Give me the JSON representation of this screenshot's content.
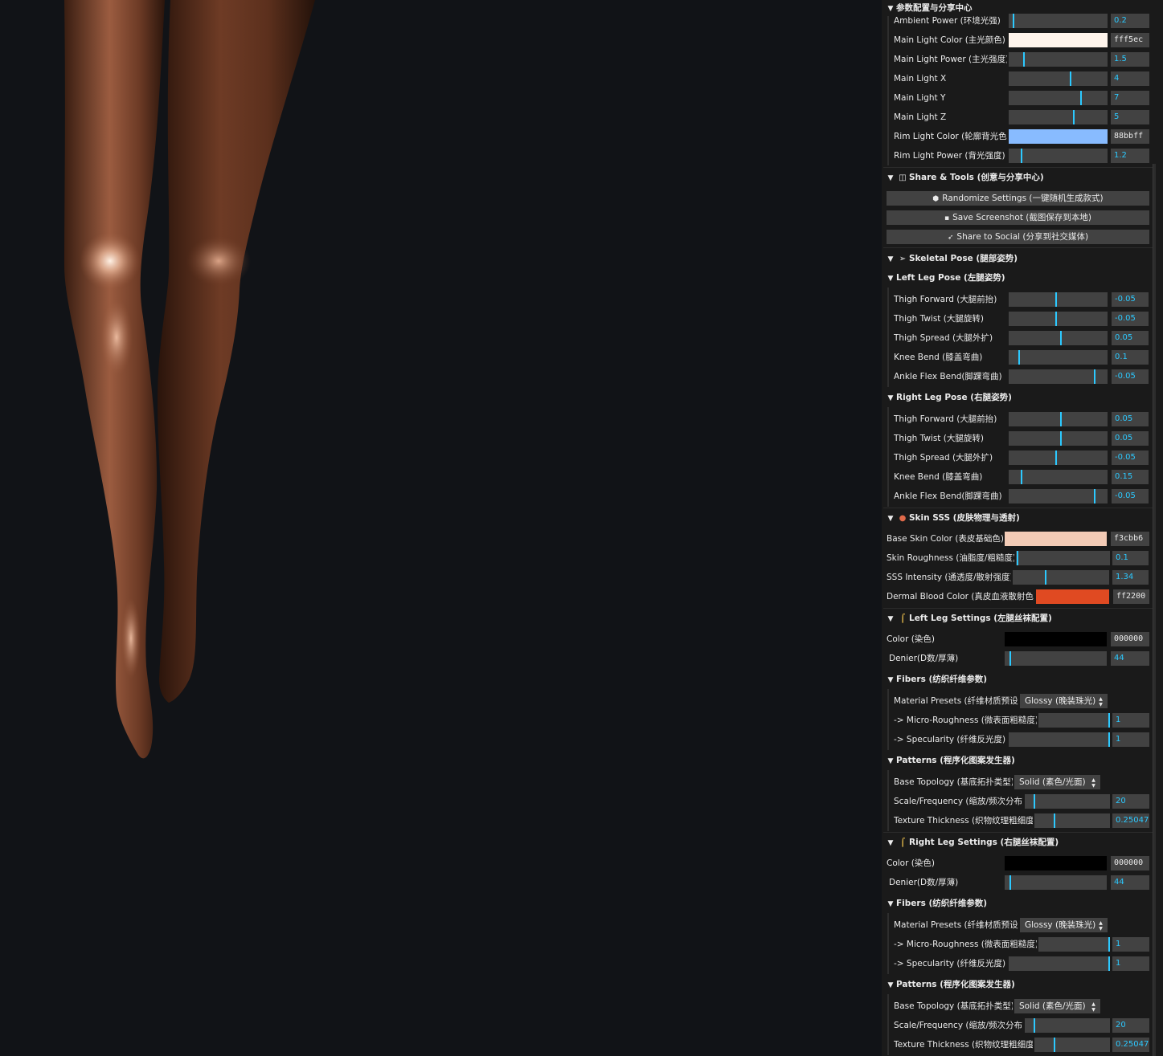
{
  "colors": {
    "accent": "#2cc9ff",
    "panel_bg": "#1a1a1a",
    "widget_bg": "#424242",
    "viewport_bg": "#111317"
  },
  "viewport": {
    "subject": "3D rendered pair of legs in sheer tights"
  },
  "top_folder": {
    "title": "参数配置与分享中心"
  },
  "lighting_rows": [
    {
      "kind": "slider",
      "label": "Ambient Power (环境光强)",
      "value": "0.2",
      "level": 0.04
    },
    {
      "kind": "color",
      "label": "Main Light Color (主光颜色)",
      "value": "fff5ec",
      "swatch": "#fff5ec"
    },
    {
      "kind": "slider",
      "label": "Main Light Power (主光强度)",
      "value": "1.5",
      "level": 0.15
    },
    {
      "kind": "slider",
      "label": "Main Light X",
      "value": "4",
      "level": 0.62
    },
    {
      "kind": "slider",
      "label": "Main Light Y",
      "value": "7",
      "level": 0.72
    },
    {
      "kind": "slider",
      "label": "Main Light Z",
      "value": "5",
      "level": 0.65
    },
    {
      "kind": "color",
      "label": "Rim Light Color (轮廓背光色)",
      "value": "88bbff",
      "swatch": "#88bbff"
    },
    {
      "kind": "slider",
      "label": "Rim Light Power (背光强度)",
      "value": "1.2",
      "level": 0.12
    }
  ],
  "share_tools": {
    "title": "Share & Tools (创意与分享中心)",
    "icon": "toolbox-icon",
    "buttons": [
      {
        "label": "Randomize Settings (一键随机生成款式)",
        "icon": "dice-icon",
        "glyph": "⬢"
      },
      {
        "label": "Save Screenshot (截图保存到本地)",
        "icon": "save-icon",
        "glyph": "▪"
      },
      {
        "label": "Share to Social (分享到社交媒体)",
        "icon": "rocket-icon",
        "glyph": "➶"
      }
    ]
  },
  "skeletal_pose": {
    "title": "Skeletal Pose (腿部姿势)",
    "icon": "bone-icon",
    "left": {
      "title": "Left Leg Pose (左腿姿势)",
      "rows": [
        {
          "label": "Thigh Forward (大腿前抬)",
          "value": "-0.05",
          "level": 0.47
        },
        {
          "label": "Thigh Twist (大腿旋转)",
          "value": "-0.05",
          "level": 0.47
        },
        {
          "label": "Thigh Spread (大腿外扩)",
          "value": "0.05",
          "level": 0.52
        },
        {
          "label": "Knee Bend (膝盖弯曲)",
          "value": "0.1",
          "level": 0.1
        },
        {
          "label": "Ankle Flex Bend(脚踝弯曲)",
          "value": "-0.05",
          "level": 0.86
        }
      ]
    },
    "right": {
      "title": "Right Leg Pose (右腿姿势)",
      "rows": [
        {
          "label": "Thigh Forward (大腿前抬)",
          "value": "0.05",
          "level": 0.52
        },
        {
          "label": "Thigh Twist (大腿旋转)",
          "value": "0.05",
          "level": 0.52
        },
        {
          "label": "Thigh Spread (大腿外扩)",
          "value": "-0.05",
          "level": 0.47
        },
        {
          "label": "Knee Bend (膝盖弯曲)",
          "value": "0.15",
          "level": 0.12
        },
        {
          "label": "Ankle Flex Bend(脚踝弯曲)",
          "value": "-0.05",
          "level": 0.86
        }
      ]
    }
  },
  "skin_sss": {
    "title": "Skin SSS (皮肤物理与透射)",
    "icon": "skin-icon",
    "rows": [
      {
        "kind": "color",
        "label": "Base Skin Color (表皮基础色)",
        "value": "f3cbb6",
        "swatch": "#f3cbb6"
      },
      {
        "kind": "slider",
        "label": "Skin Roughness (油脂度/粗糙度)",
        "value": "0.1",
        "level": 0.01
      },
      {
        "kind": "slider",
        "label": "SSS Intensity (通透度/散射强度)",
        "value": "1.34",
        "level": 0.33
      },
      {
        "kind": "color",
        "label": "Dermal Blood Color (真皮血液散射色)",
        "value": "ff2200",
        "swatch": "#e04a22"
      }
    ]
  },
  "legs": [
    {
      "title": "Left Leg Settings (左腿丝袜配置)",
      "icon": "stocking-icon",
      "color_label": "Color (染色)",
      "color_value": "000000",
      "color_swatch": "#000000",
      "denier_label": "Denier(D数/厚薄)",
      "denier_value": "44",
      "denier_level": 0.05,
      "fibers": {
        "title": "Fibers (纺织纤维参数)",
        "preset_label": "Material Presets (纤维材质预设)",
        "preset_value": "Glossy (晚装珠光)",
        "rough_label": "-> Micro-Roughness (微表面粗糙度)",
        "rough_value": "1",
        "rough_level": 1,
        "spec_label": "-> Specularity (纤维反光度)",
        "spec_value": "1",
        "spec_level": 1
      },
      "patterns": {
        "title": "Patterns (程序化图案发生器)",
        "topology_label": "Base Topology (基底拓扑类型)",
        "topology_value": "Solid (素色/光面)",
        "scale_label": "Scale/Frequency (缩放/频次分布)",
        "scale_value": "20",
        "scale_level": 0.1,
        "thick_label": "Texture Thickness (织物纹理粗细度)",
        "thick_value": "0.25047",
        "thick_level": 0.25
      }
    },
    {
      "title": "Right Leg Settings (右腿丝袜配置)",
      "icon": "stocking-icon",
      "color_label": "Color (染色)",
      "color_value": "000000",
      "color_swatch": "#000000",
      "denier_label": "Denier(D数/厚薄)",
      "denier_value": "44",
      "denier_level": 0.05,
      "fibers": {
        "title": "Fibers (纺织纤维参数)",
        "preset_label": "Material Presets (纤维材质预设)",
        "preset_value": "Glossy (晚装珠光)",
        "rough_label": "-> Micro-Roughness (微表面粗糙度)",
        "rough_value": "1",
        "rough_level": 1,
        "spec_label": "-> Specularity (纤维反光度)",
        "spec_value": "1",
        "spec_level": 1
      },
      "patterns": {
        "title": "Patterns (程序化图案发生器)",
        "topology_label": "Base Topology (基底拓扑类型)",
        "topology_value": "Solid (素色/光面)",
        "scale_label": "Scale/Frequency (缩放/频次分布)",
        "scale_value": "20",
        "scale_level": 0.1,
        "thick_label": "Texture Thickness (织物纹理粗细度)",
        "thick_value": "0.25047",
        "thick_level": 0.25
      }
    }
  ]
}
